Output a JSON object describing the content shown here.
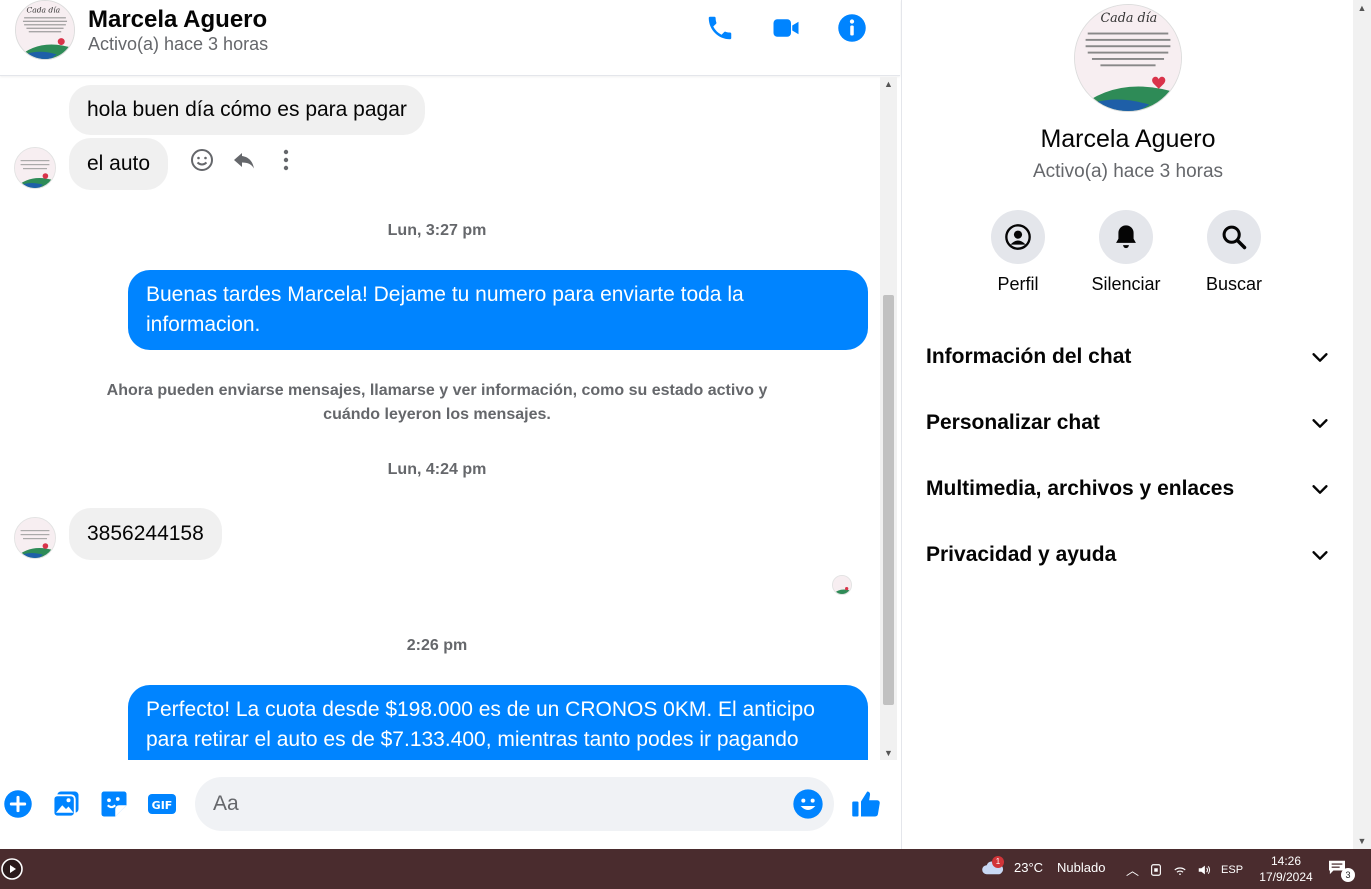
{
  "header": {
    "name": "Marcela Aguero",
    "status": "Activo(a) hace 3 horas",
    "buttons": [
      "phone-icon",
      "video-icon",
      "info-icon"
    ]
  },
  "messages": {
    "incoming_1": "hola buen día cómo es para pagar",
    "incoming_2": "el auto",
    "timestamp_1": "Lun, 3:27 pm",
    "outgoing_1": "Buenas tardes Marcela! Dejame tu numero para enviarte toda la informacion.",
    "system_notice": "Ahora pueden enviarse mensajes, llamarse y ver información, como su estado activo y cuándo leyeron los mensajes.",
    "timestamp_2": "Lun, 4:24 pm",
    "incoming_3": "3856244158",
    "timestamp_3": "2:26 pm",
    "outgoing_2": "Perfecto! La cuota desde $198.000 es de un CRONOS 0KM. El anticipo para retirar el auto es de $7.133.400, mientras tanto podes ir pagando"
  },
  "composer": {
    "placeholder": "Aa",
    "icons": [
      "plus-icon",
      "image-icon",
      "sticker-icon",
      "gif-icon",
      "emoji-icon",
      "like-icon"
    ],
    "gif_label": "GIF"
  },
  "sidebar": {
    "name": "Marcela Aguero",
    "status": "Activo(a) hace 3 horas",
    "actions": [
      {
        "label": "Perfil",
        "icon": "profile-icon"
      },
      {
        "label": "Silenciar",
        "icon": "bell-icon"
      },
      {
        "label": "Buscar",
        "icon": "search-icon"
      }
    ],
    "sections": [
      {
        "label": "Información del chat"
      },
      {
        "label": "Personalizar chat"
      },
      {
        "label": "Multimedia, archivos y enlaces"
      },
      {
        "label": "Privacidad y ayuda"
      }
    ]
  },
  "avatar_text": {
    "script": "Cada día",
    "body": "Cada día y cada mañana tenemos la opción de agradecer y valorar cada momento, cada experiencia de la vida. Lo bueno y lo no tan bueno porque todo absolutamente todo es necesario para CRECER."
  },
  "taskbar": {
    "temperature": "23°C",
    "weather": "Nublado",
    "weather_badge": "1",
    "language": "ESP",
    "time": "14:26",
    "date": "17/9/2024",
    "notifications": "3"
  },
  "colors": {
    "accent": "#0084ff",
    "incoming_bubble": "#f0f0f0",
    "taskbar": "#4a2c2e"
  }
}
